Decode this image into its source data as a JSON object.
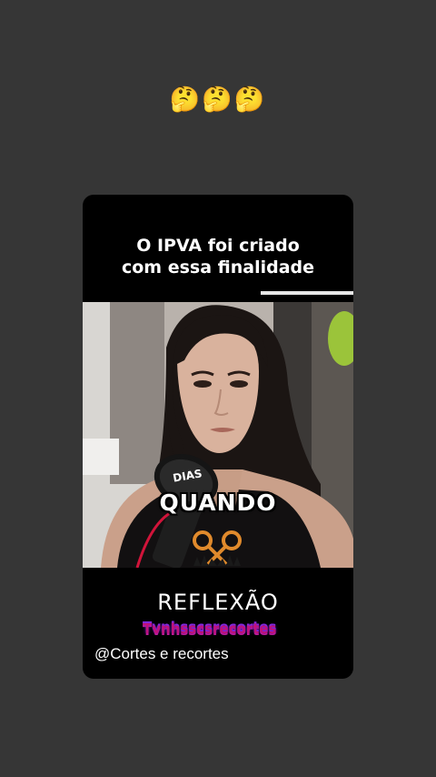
{
  "story": {
    "emoji_sticker": "🤔🤔🤔"
  },
  "post": {
    "headline_line1": "O IPVA foi criado",
    "headline_line2": "com essa finalidade",
    "video_caption": "QUANDO",
    "microphone_brand_top": "DIAS",
    "reflection_label": "REFLEXÃO",
    "glitch_text": "Tvnhsscsrecortes",
    "account_handle": "@Cortes e recortes"
  },
  "colors": {
    "story_background": "#363636",
    "card_background": "#000000",
    "caption_text": "#ffffff",
    "glitch_magenta": "#c0127a",
    "scissors_orange": "#e08a2c"
  },
  "icons": {
    "scissors_logo": "scissors-icon"
  }
}
